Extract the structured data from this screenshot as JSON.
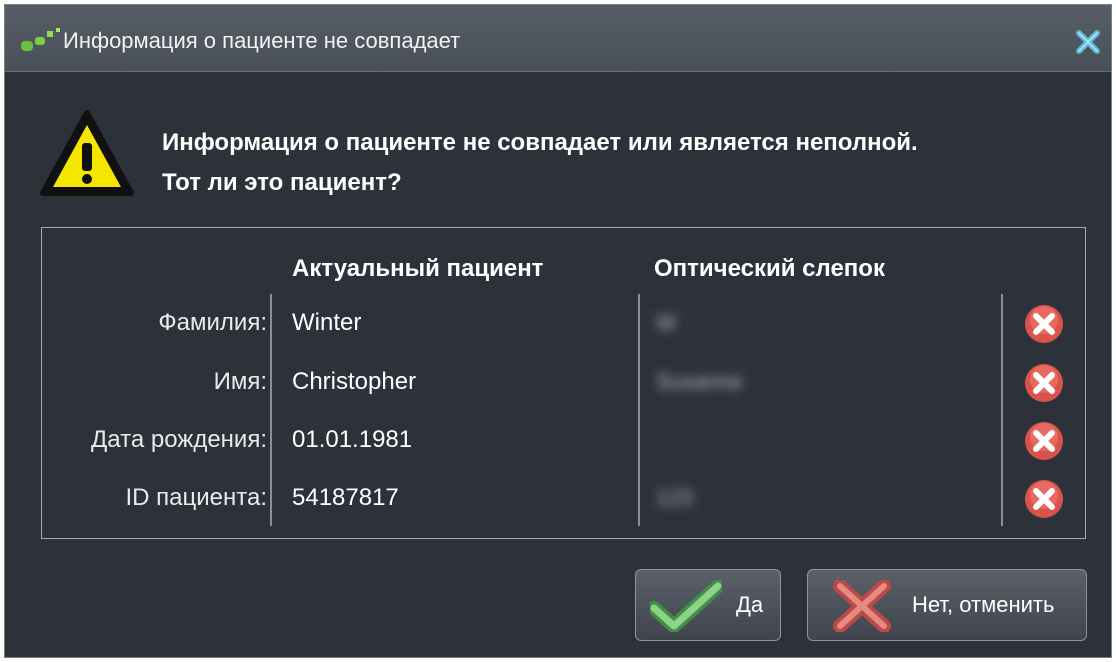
{
  "window": {
    "title": "Информация о пациенте не совпадает",
    "app_icon": "app-logo-icon",
    "close_icon": "close-icon"
  },
  "message": {
    "icon": "warning-icon",
    "line1": "Информация о пациенте не совпадает или является неполной.",
    "line2": "Тот ли это пациент?"
  },
  "table": {
    "columns": {
      "current": "Актуальный пациент",
      "scan": "Оптический слепок"
    },
    "rows": [
      {
        "label": "Фамилия:",
        "current": "Winter",
        "scan": "W",
        "status_icon": "error-icon"
      },
      {
        "label": "Имя:",
        "current": "Christopher",
        "scan": "Susanne",
        "status_icon": "error-icon"
      },
      {
        "label": "Дата рождения:",
        "current": "01.01.1981",
        "scan": "",
        "status_icon": "error-icon"
      },
      {
        "label": "ID пациента:",
        "current": "54187817",
        "scan": "123",
        "status_icon": "error-icon"
      }
    ]
  },
  "buttons": {
    "yes": {
      "label": "Да",
      "icon": "checkmark-icon"
    },
    "no": {
      "label": "Нет, отменить",
      "icon": "cross-icon"
    }
  },
  "colors": {
    "background": "#2d323a",
    "titlebar": "#4f555e",
    "warning_yellow": "#f5e600",
    "error_red": "#d9534a",
    "check_green": "#6fbf6a"
  }
}
